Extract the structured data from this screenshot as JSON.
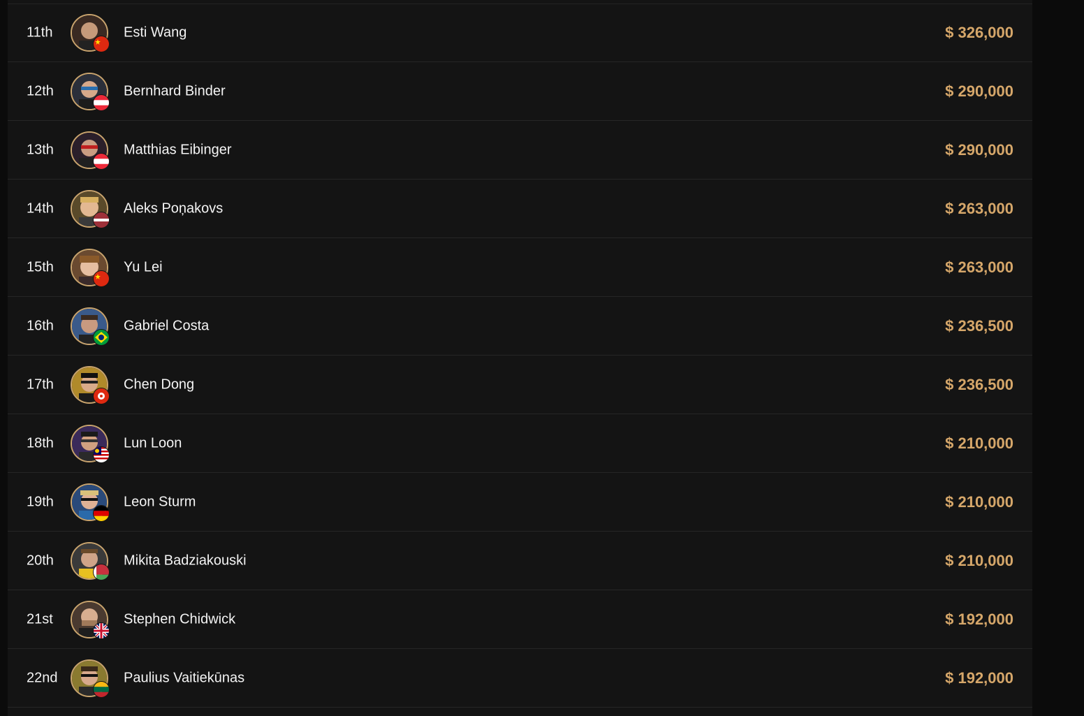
{
  "colors": {
    "background": "#141414",
    "prize": "#d6a76a",
    "avatar_ring": "#c9a46e",
    "text": "#f4f4f4"
  },
  "results": [
    {
      "rank": "11th",
      "name": "Esti Wang",
      "prize": "$ 326,000",
      "flag": "china-flag-icon"
    },
    {
      "rank": "12th",
      "name": "Bernhard Binder",
      "prize": "$ 290,000",
      "flag": "austria-flag-icon"
    },
    {
      "rank": "13th",
      "name": "Matthias Eibinger",
      "prize": "$ 290,000",
      "flag": "austria-flag-icon"
    },
    {
      "rank": "14th",
      "name": "Aleks Poņakovs",
      "prize": "$ 263,000",
      "flag": "latvia-flag-icon"
    },
    {
      "rank": "15th",
      "name": "Yu Lei",
      "prize": "$ 263,000",
      "flag": "china-flag-icon"
    },
    {
      "rank": "16th",
      "name": "Gabriel Costa",
      "prize": "$ 236,500",
      "flag": "brazil-flag-icon"
    },
    {
      "rank": "17th",
      "name": "Chen Dong",
      "prize": "$ 236,500",
      "flag": "hong-kong-flag-icon"
    },
    {
      "rank": "18th",
      "name": "Lun Loon",
      "prize": "$ 210,000",
      "flag": "malaysia-flag-icon"
    },
    {
      "rank": "19th",
      "name": "Leon Sturm",
      "prize": "$ 210,000",
      "flag": "germany-flag-icon"
    },
    {
      "rank": "20th",
      "name": "Mikita Badziakouski",
      "prize": "$ 210,000",
      "flag": "belarus-flag-icon"
    },
    {
      "rank": "21st",
      "name": "Stephen Chidwick",
      "prize": "$ 192,000",
      "flag": "uk-flag-icon"
    },
    {
      "rank": "22nd",
      "name": "Paulius Vaitiekūnas",
      "prize": "$ 192,000",
      "flag": "lithuania-flag-icon"
    }
  ]
}
